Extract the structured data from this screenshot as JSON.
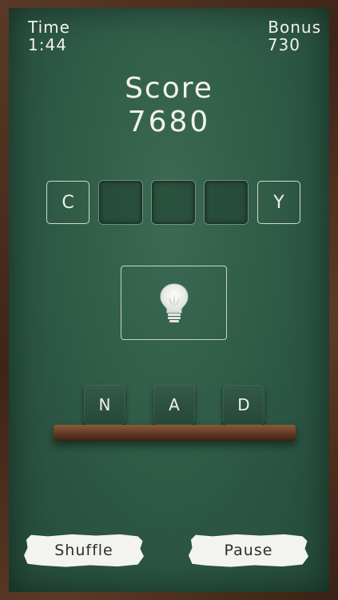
{
  "hud": {
    "time_label": "Time",
    "time_value": "1:44",
    "bonus_label": "Bonus",
    "bonus_value": "730"
  },
  "score": {
    "label": "Score",
    "value": "7680"
  },
  "answer_slots": [
    "C",
    "",
    "",
    "",
    "Y"
  ],
  "hint": {
    "icon": "lightbulb-icon"
  },
  "letter_tiles": [
    "N",
    "A",
    "D"
  ],
  "buttons": {
    "shuffle": "Shuffle",
    "pause": "Pause"
  },
  "colors": {
    "board": "#2f5b47",
    "chalk": "#f2f2ec",
    "frame": "#4a2d1c",
    "shelf": "#6a4028"
  }
}
